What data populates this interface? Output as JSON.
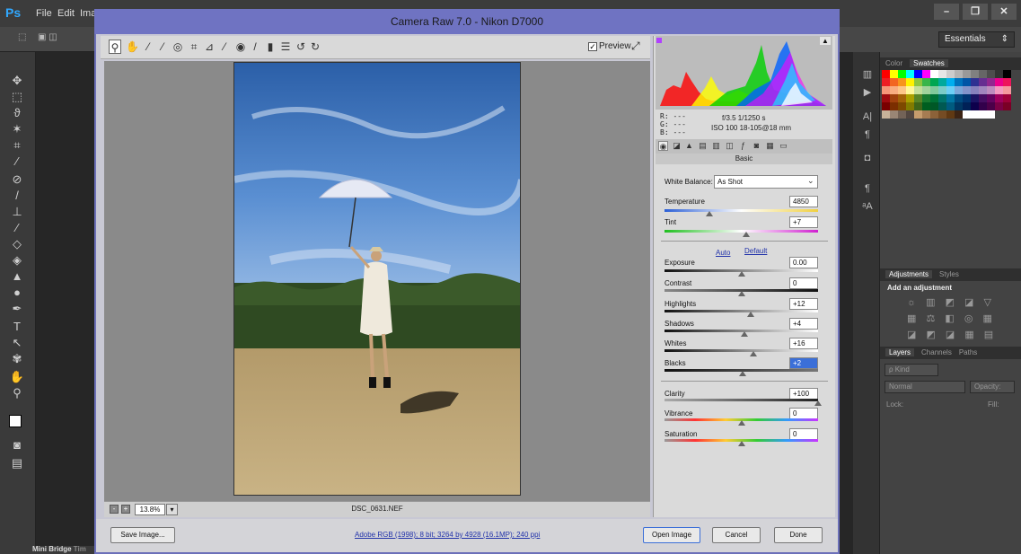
{
  "ps": {
    "logo": "Ps",
    "menu": [
      "File",
      "Edit",
      "Ima"
    ],
    "workspace": "Essentials",
    "win_min": "–",
    "win_max": "❐",
    "win_close": "✕",
    "mini_bridge": "Mini Bridge",
    "mini_bridge_next": "Tim",
    "panel_swatch_tabs": [
      "Color",
      "Swatches"
    ],
    "panel_adj_tabs": [
      "Adjustments",
      "Styles"
    ],
    "adj_title": "Add an adjustment",
    "panel_layer_tabs": [
      "Layers",
      "Channels",
      "Paths"
    ],
    "layers_kind": "ρ Kind",
    "blend_mode": "Normal",
    "opacity_label": "Opacity:",
    "lock_label": "Lock:",
    "fill_label": "Fill:"
  },
  "camera_raw": {
    "title": "Camera Raw 7.0  -  Nikon D7000",
    "preview_label": "Preview",
    "preview_checked": "✓",
    "zoom": "13.8%",
    "zoom_dropdown": "▾",
    "zoom_out": "-",
    "zoom_in": "+",
    "filename": "DSC_0631.NEF",
    "rgb_readout": [
      "R:  ---",
      "G:  ---",
      "B:  ---"
    ],
    "aperture_shutter": "f/3.5   1/1250 s",
    "iso_lens": "ISO 100   18-105@18 mm",
    "panel_name": "Basic",
    "white_balance_label": "White Balance:",
    "white_balance_value": "As Shot",
    "auto_link": "Auto",
    "default_link": "Default",
    "sliders": {
      "temperature": {
        "label": "Temperature",
        "value": "4850",
        "position": 0.29
      },
      "tint": {
        "label": "Tint",
        "value": "+7",
        "position": 0.53
      },
      "exposure": {
        "label": "Exposure",
        "value": "0.00",
        "position": 0.5
      },
      "contrast": {
        "label": "Contrast",
        "value": "0",
        "position": 0.5
      },
      "highlights": {
        "label": "Highlights",
        "value": "+12",
        "position": 0.56
      },
      "shadows": {
        "label": "Shadows",
        "value": "+4",
        "position": 0.52
      },
      "whites": {
        "label": "Whites",
        "value": "+16",
        "position": 0.58
      },
      "blacks": {
        "label": "Blacks",
        "value": "+2",
        "position": 0.51
      },
      "clarity": {
        "label": "Clarity",
        "value": "+100",
        "position": 1.0
      },
      "vibrance": {
        "label": "Vibrance",
        "value": "0",
        "position": 0.5
      },
      "saturation": {
        "label": "Saturation",
        "value": "0",
        "position": 0.5
      }
    },
    "save_button": "Save Image...",
    "workflow_link": "Adobe RGB (1998); 8 bit; 3264 by 4928 (16.1MP); 240 ppi",
    "open_button": "Open Image",
    "cancel_button": "Cancel",
    "done_button": "Done"
  },
  "colors": {
    "dialog_titlebar": "#6f73c2",
    "ps_blue": "#31a8ff"
  }
}
